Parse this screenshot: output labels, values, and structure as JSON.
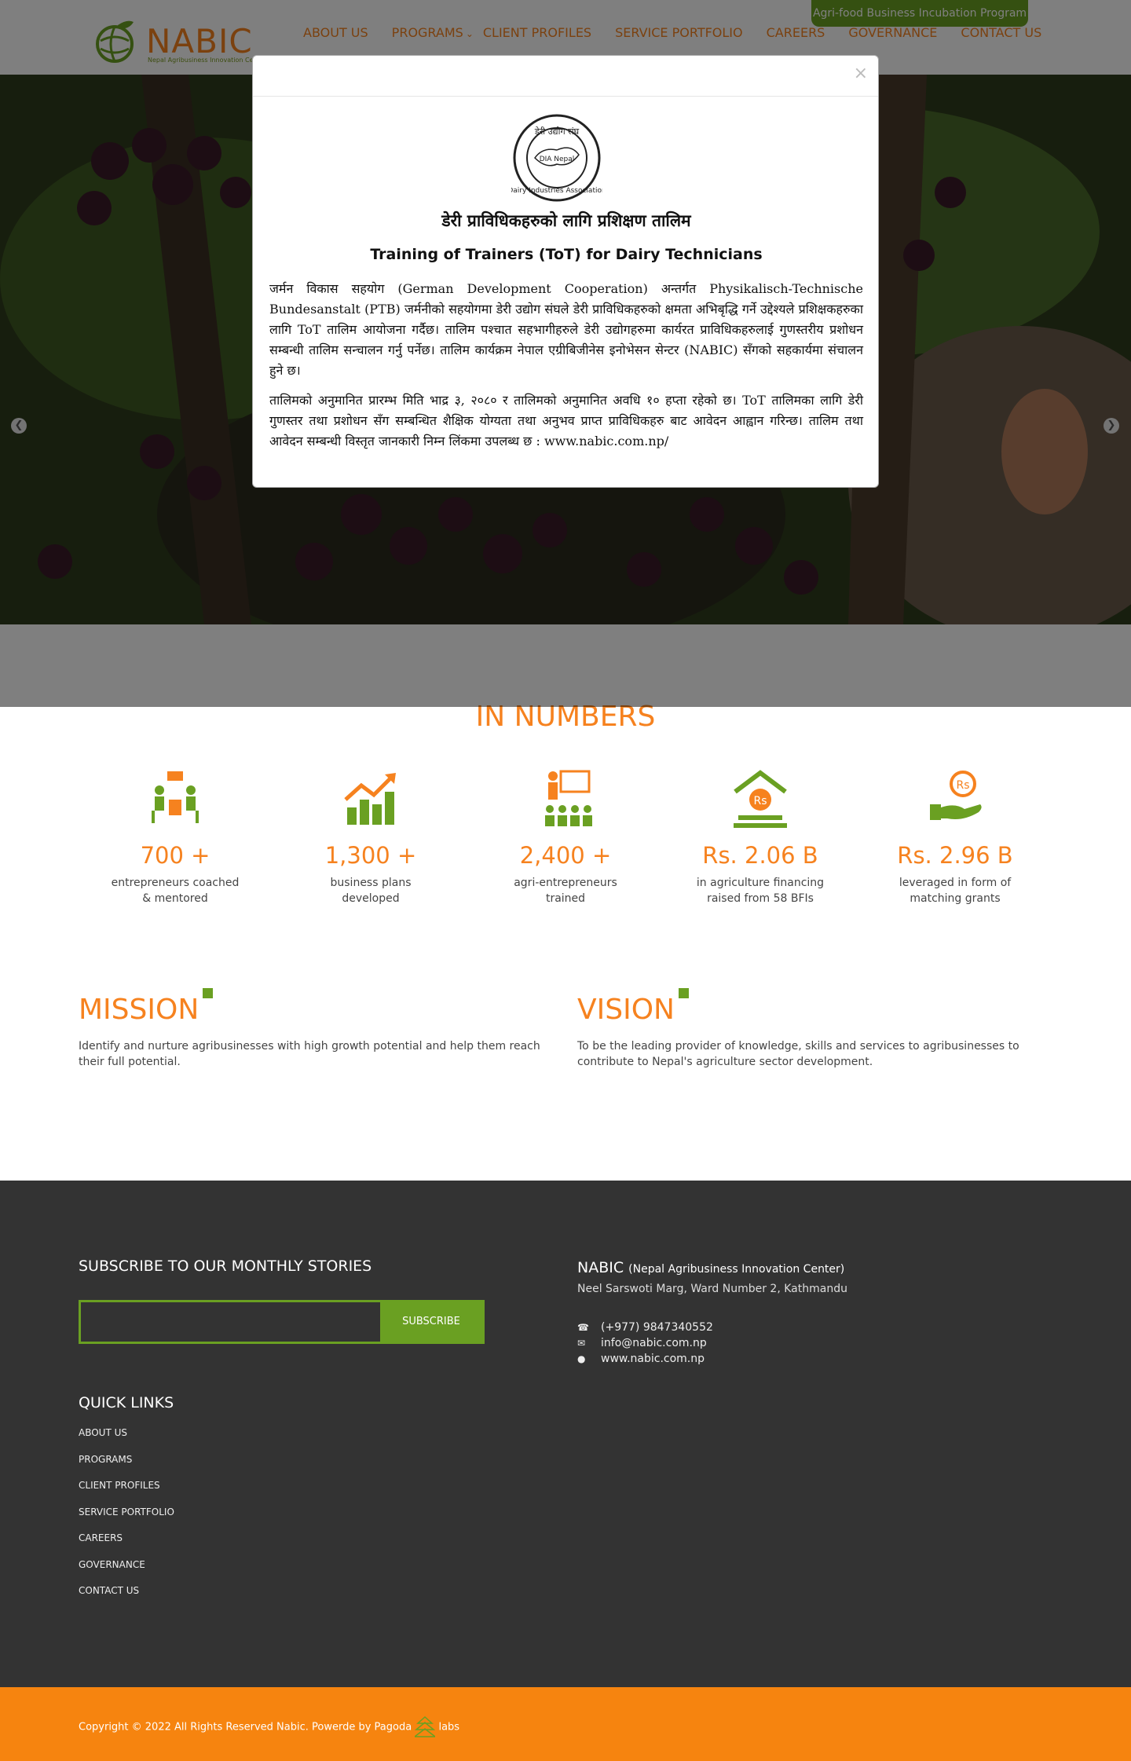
{
  "header": {
    "logo_text": "NABIC",
    "logo_sub": "Nepal Agribusiness Innovation Center",
    "top_badge": "Agri-food Business Incubation Program",
    "nav": [
      "ABOUT US",
      "PROGRAMS",
      "CLIENT PROFILES",
      "SERVICE PORTFOLIO",
      "CAREERS",
      "GOVERNANCE",
      "CONTACT US"
    ]
  },
  "hero": {
    "prev_icon": "chevron-left-icon",
    "next_icon": "chevron-right-icon"
  },
  "modal": {
    "close": "×",
    "seal_text": "Dairy Industries Association",
    "seal_top": "डेरी उद्योग संघ",
    "seal_mid": "DIA Nepal",
    "title_np": "डेरी प्राविधिकहरुको लागि प्रशिक्षण तालिम",
    "title_en": "Training of Trainers (ToT) for Dairy Technicians",
    "para1": "जर्मन विकास सहयोग (German Development Cooperation) अन्तर्गत Physikalisch-Technische Bundesanstalt (PTB) जर्मनीको सहयोगमा डेरी उद्योग संघले डेरी प्राविधिकहरुको क्षमता अभिबृद्धि गर्ने उद्देश्यले प्रशिक्षकहरुका लागि ToT तालिम आयोजना गर्दैछ। तालिम पश्चात सहभागीहरुले डेरी उद्योगहरुमा कार्यरत प्राविधिकहरुलाई गुणस्तरीय प्रशोधन सम्बन्धी तालिम सन्चालन गर्नु पर्नेछ। तालिम कार्यक्रम नेपाल एग्रीबिजीनेस इनोभेसन सेन्टर (NABIC) सँगको सहकार्यमा संचालन हुने छ।",
    "para2": "तालिमको अनुमानित प्रारम्भ मिति भाद्र ३, २०८० र तालिमको अनुमानित अवधि १० हप्ता रहेको छ। ToT तालिमका लागि डेरी गुणस्तर तथा प्रशोधन सँग सम्बन्धित शैक्षिक योग्यता तथा अनुभव प्राप्त प्राविधिकहरु बाट आवेदन आह्वान गरिन्छ। तालिम तथा आवेदन सम्बन्धी विस्तृत जानकारी निम्न लिंकमा उपलब्ध छ : www.nabic.com.np/"
  },
  "numbers": {
    "title": "IN NUMBERS",
    "stats": [
      {
        "icon": "mentoring-icon",
        "value": "700 +",
        "desc1": "entrepreneurs coached",
        "desc2": "& mentored"
      },
      {
        "icon": "growth-chart-icon",
        "value": "1,300 +",
        "desc1": "business plans",
        "desc2": "developed"
      },
      {
        "icon": "training-icon",
        "value": "2,400 +",
        "desc1": "agri-entrepreneurs",
        "desc2": "trained"
      },
      {
        "icon": "bank-rs-icon",
        "value": "Rs. 2.06 B",
        "desc1": "in agriculture financing",
        "desc2": "raised from 58 BFIs"
      },
      {
        "icon": "grant-hand-icon",
        "value": "Rs. 2.96 B",
        "desc1": "leveraged in form of",
        "desc2": "matching grants"
      }
    ]
  },
  "mission": {
    "title": "MISSION",
    "text": "Identify and nurture agribusinesses with high growth potential and help them reach their full potential."
  },
  "vision": {
    "title": "VISION",
    "text": "To be the leading provider of knowledge, skills and services to agribusinesses to contribute to Nepal's agriculture sector development."
  },
  "footer": {
    "subscribe_title": "SUBSCRIBE TO OUR MONTHLY STORIES",
    "subscribe_button": "SUBSCRIBE",
    "subscribe_placeholder": "",
    "quick_links_title": "QUICK LINKS",
    "quick_links": [
      "ABOUT US",
      "PROGRAMS",
      "CLIENT PROFILES",
      "SERVICE PORTFOLIO",
      "CAREERS",
      "GOVERNANCE",
      "CONTACT US"
    ],
    "org_name": "NABIC",
    "org_full": "(Nepal Agribusiness  Innovation Center)",
    "address": "Neel Sarswoti  Marg, Ward Number 2, Kathmandu",
    "phone": "(+977) 9847340552",
    "email": "info@nabic.com.np",
    "website": "www.nabic.com.np"
  },
  "copyright": {
    "text": "Copyright © 2022 All Rights Reserved Nabic. Powerde by Pagoda",
    "suffix": "labs"
  },
  "colors": {
    "orange": "#f6821f",
    "green": "#6aa022",
    "footer": "#333333",
    "copyright_bar": "#f6840f"
  }
}
